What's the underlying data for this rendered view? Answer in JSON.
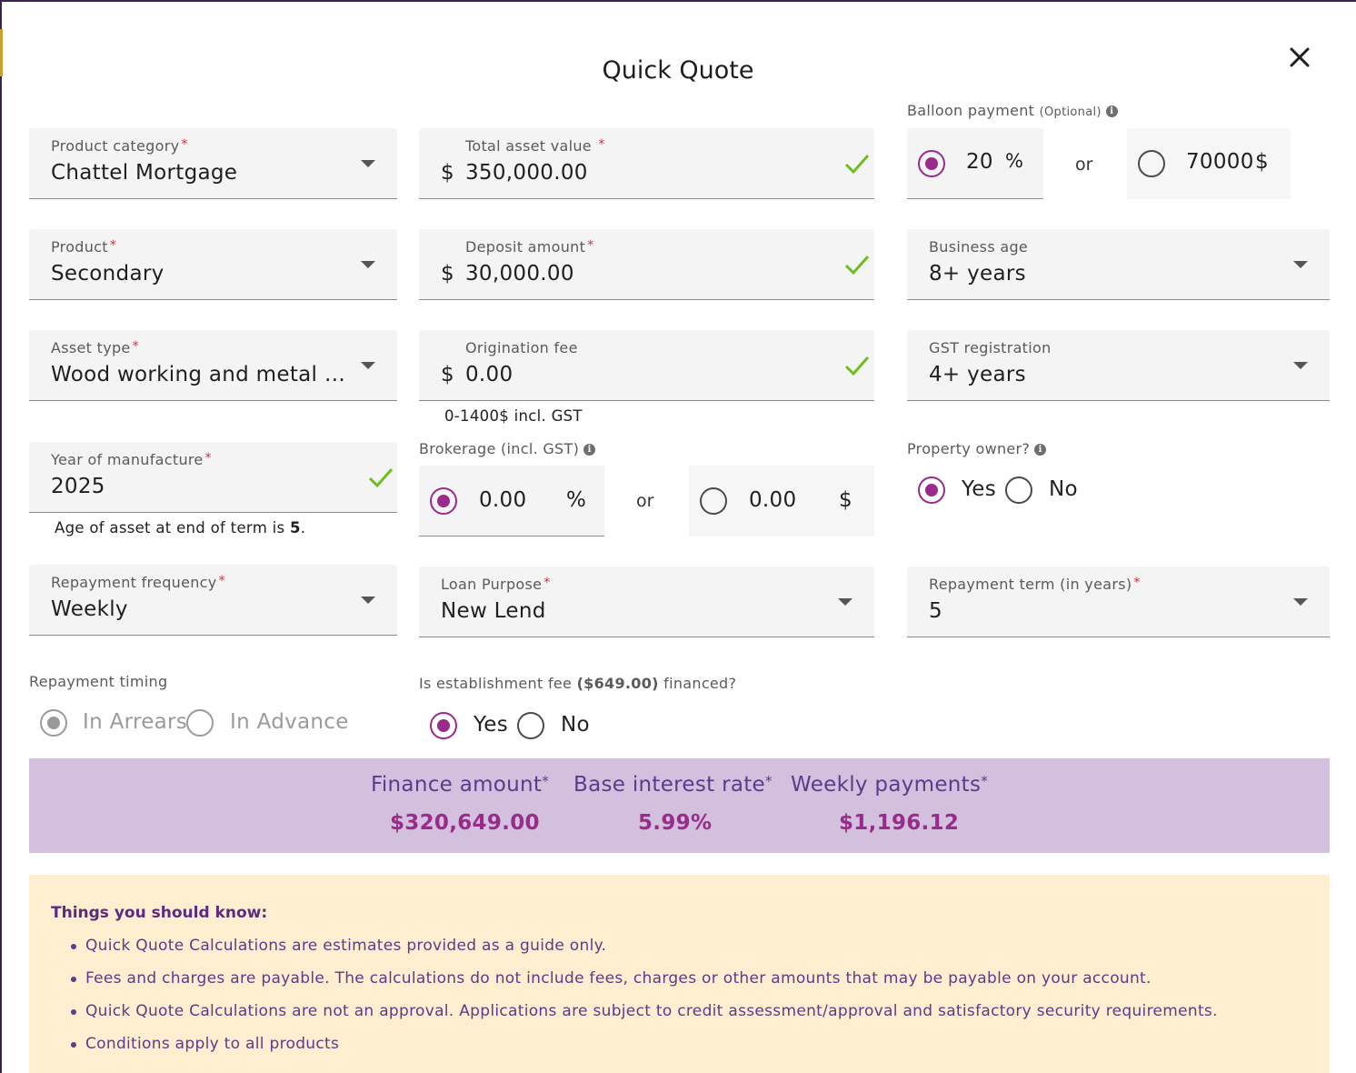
{
  "modal": {
    "title": "Quick Quote"
  },
  "product_category": {
    "label": "Product category",
    "value": "Chattel Mortgage"
  },
  "product": {
    "label": "Product",
    "value": "Secondary"
  },
  "asset_type": {
    "label": "Asset type",
    "value": "Wood working and metal w..."
  },
  "year_of_manufacture": {
    "label": "Year of manufacture",
    "value": "2025",
    "helper_prefix": "Age of asset at end of term is ",
    "helper_value": "5",
    "helper_suffix": "."
  },
  "repayment_frequency": {
    "label": "Repayment frequency",
    "value": "Weekly"
  },
  "repayment_timing": {
    "label": "Repayment timing",
    "option_arrears": "In Arrears",
    "option_advance": "In Advance",
    "selected": "In Arrears"
  },
  "total_asset_value": {
    "label": "Total asset value",
    "currency": "$",
    "value": "350,000.00"
  },
  "deposit_amount": {
    "label": "Deposit amount",
    "currency": "$",
    "value": "30,000.00"
  },
  "origination_fee": {
    "label": "Origination fee",
    "currency": "$",
    "value": "0.00",
    "helper": "0-1400$ incl. GST"
  },
  "brokerage": {
    "label": "Brokerage (incl. GST)",
    "percent_value": "0.00",
    "percent_unit": "%",
    "or": "or",
    "dollar_placeholder": "0.00",
    "dollar_unit": "$",
    "selected": "percent"
  },
  "loan_purpose": {
    "label": "Loan Purpose",
    "value": "New Lend"
  },
  "establishment_fee": {
    "label_prefix": "Is establishment fee ",
    "amount": "($649.00)",
    "label_suffix": " financed?",
    "option_yes": "Yes",
    "option_no": "No",
    "selected": "Yes"
  },
  "balloon_payment": {
    "label": "Balloon payment",
    "optional": "(Optional)",
    "percent_value": "20",
    "percent_unit": "%",
    "or": "or",
    "dollar_placeholder": "70000",
    "dollar_unit": "$",
    "selected": "percent"
  },
  "business_age": {
    "label": "Business age",
    "value": "8+ years"
  },
  "gst_registration": {
    "label": "GST registration",
    "value": "4+ years"
  },
  "property_owner": {
    "label": "Property owner?",
    "option_yes": "Yes",
    "option_no": "No",
    "selected": "Yes"
  },
  "repayment_term": {
    "label": "Repayment term (in years)",
    "value": "5"
  },
  "summary": {
    "finance_amount_label": "Finance amount",
    "finance_amount_value": "$320,649.00",
    "base_rate_label": "Base interest rate",
    "base_rate_value": "5.99%",
    "weekly_payments_label": "Weekly payments",
    "weekly_payments_value": "$1,196.12",
    "asterisk": "*"
  },
  "notice": {
    "heading": "Things you should know:",
    "items": [
      "Quick Quote Calculations are estimates provided as a guide only.",
      "Fees and charges are payable. The calculations do not include fees, charges or other amounts that may be payable on your account.",
      "Quick Quote Calculations are not an approval. Applications are subject to credit assessment/approval and satisfactory security requirements.",
      "Conditions apply to all products"
    ]
  },
  "required_marker": "*",
  "info_icon_glyph": "i",
  "colors": {
    "accent": "#9b2b8a",
    "summary_bg": "#d2c0de",
    "notice_bg": "#fdefcf",
    "check": "#6cbd1d",
    "summary_text": "#5d3a8a"
  }
}
